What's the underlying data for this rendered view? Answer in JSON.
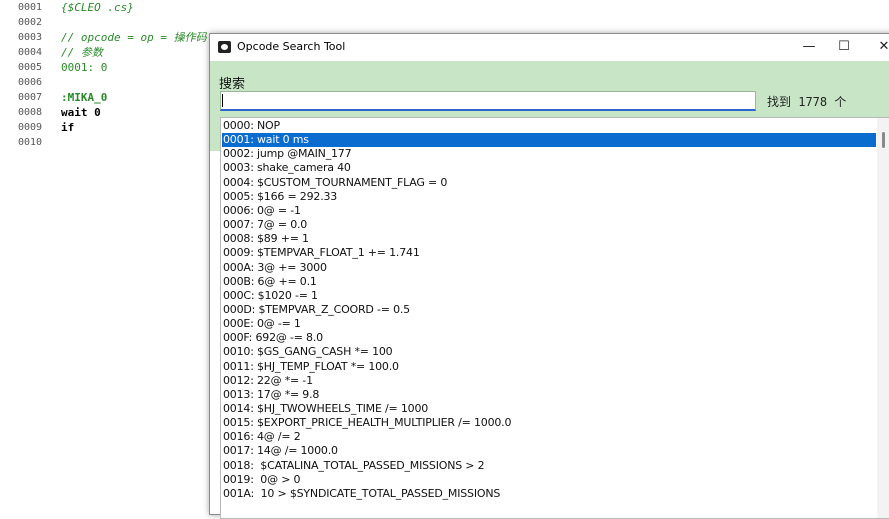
{
  "editor": {
    "lines": [
      {
        "num": "0001",
        "code": "{$CLEO .cs}",
        "cls": "c-comment"
      },
      {
        "num": "0002",
        "code": "",
        "cls": ""
      },
      {
        "num": "0003",
        "code": "// opcode = op = 操作码",
        "cls": "c-comment"
      },
      {
        "num": "0004",
        "code": "// 参数",
        "cls": "c-comment"
      },
      {
        "num": "0005",
        "code": "0001: 0",
        "cls": "c-num"
      },
      {
        "num": "0006",
        "code": "",
        "cls": ""
      },
      {
        "num": "0007",
        "code": ":MIKA_0",
        "cls": "c-label"
      },
      {
        "num": "0008",
        "code": "wait 0",
        "cls": "c-kw"
      },
      {
        "num": "0009",
        "code": "if",
        "cls": "c-kw"
      },
      {
        "num": "0010",
        "code": "",
        "cls": ""
      }
    ]
  },
  "dialog": {
    "title": "Opcode Search Tool",
    "minimize": "—",
    "maximize": "☐",
    "close": "✕",
    "search_label": "搜索",
    "search_value": "",
    "found_text": "找到 1778 个"
  },
  "results": [
    "0000: NOP",
    "0001: wait 0 ms",
    "0002: jump @MAIN_177",
    "0003: shake_camera 40",
    "0004: $CUSTOM_TOURNAMENT_FLAG = 0",
    "0005: $166 = 292.33",
    "0006: 0@ = -1",
    "0007: 7@ = 0.0",
    "0008: $89 += 1",
    "0009: $TEMPVAR_FLOAT_1 += 1.741",
    "000A: 3@ += 3000",
    "000B: 6@ += 0.1",
    "000C: $1020 -= 1",
    "000D: $TEMPVAR_Z_COORD -= 0.5",
    "000E: 0@ -= 1",
    "000F: 692@ -= 8.0",
    "0010: $GS_GANG_CASH *= 100",
    "0011: $HJ_TEMP_FLOAT *= 100.0",
    "0012: 22@ *= -1",
    "0013: 17@ *= 9.8",
    "0014: $HJ_TWOWHEELS_TIME /= 1000",
    "0015: $EXPORT_PRICE_HEALTH_MULTIPLIER /= 1000.0",
    "0016: 4@ /= 2",
    "0017: 14@ /= 1000.0",
    "0018:  $CATALINA_TOTAL_PASSED_MISSIONS > 2",
    "0019:  0@ > 0",
    "001A:  10 > $SYNDICATE_TOTAL_PASSED_MISSIONS"
  ],
  "selected_index": 1
}
